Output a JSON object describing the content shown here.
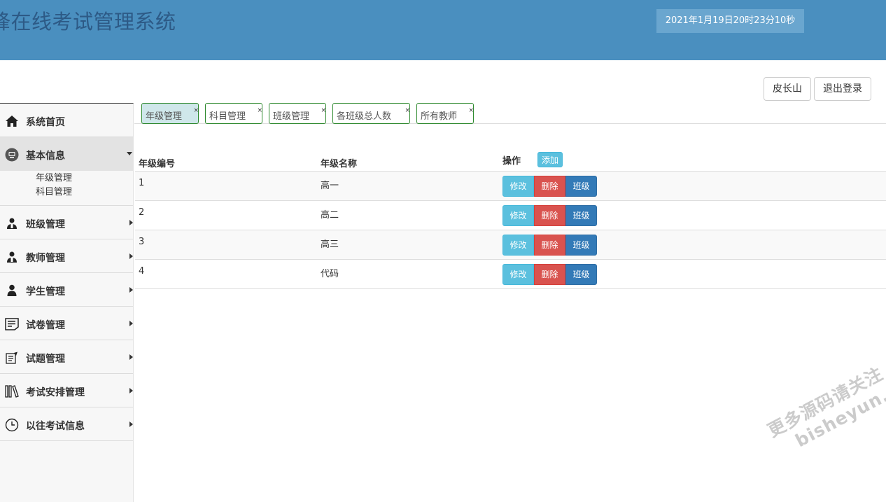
{
  "header": {
    "title": "锋在线考试管理系统",
    "clock": "2021年1月19日20时23分10秒"
  },
  "topbar": {
    "user_label": "皮长山",
    "logout_label": "退出登录"
  },
  "sidebar": {
    "items": [
      {
        "label": "系统首页",
        "icon": "home-icon"
      },
      {
        "label": "基本信息",
        "icon": "monitor-icon"
      },
      {
        "label": "班级管理",
        "icon": "user-group-icon"
      },
      {
        "label": "教师管理",
        "icon": "user-group-icon"
      },
      {
        "label": "学生管理",
        "icon": "user-icon"
      },
      {
        "label": "试卷管理",
        "icon": "document-icon"
      },
      {
        "label": "试题管理",
        "icon": "notepad-icon"
      },
      {
        "label": "考试安排管理",
        "icon": "books-icon"
      },
      {
        "label": "以往考试信息",
        "icon": "clock-icon"
      }
    ],
    "submenu": [
      "年级管理",
      "科目管理"
    ]
  },
  "tabs": [
    {
      "label": "年级管理",
      "close": "×"
    },
    {
      "label": "科目管理",
      "close": "×"
    },
    {
      "label": "班级管理",
      "close": "×"
    },
    {
      "label": "各班级总人数",
      "close": "×"
    },
    {
      "label": "所有教师",
      "close": "×"
    }
  ],
  "table": {
    "headers": [
      "年级编号",
      "年级名称",
      "操作"
    ],
    "add_label": "添加",
    "rows": [
      {
        "id": "1",
        "name": "高一"
      },
      {
        "id": "2",
        "name": "高二"
      },
      {
        "id": "3",
        "name": "高三"
      },
      {
        "id": "4",
        "name": "代码"
      }
    ],
    "actions": {
      "edit": "修改",
      "delete": "删除",
      "class": "班级"
    }
  },
  "watermark": {
    "line1": "更多源码请关注",
    "line2": "bisheyun.org"
  },
  "colors": {
    "header_bg": "#4a8fbf",
    "info": "#5bc0de",
    "danger": "#d9534f",
    "primary": "#337ab7",
    "tab_border": "#2f8a2f"
  }
}
